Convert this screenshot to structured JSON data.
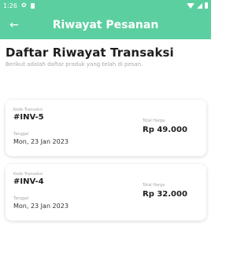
{
  "status_bar": {
    "time": "1:26"
  },
  "app_bar": {
    "title": "Riwayat Pesanan",
    "back_icon": "arrow-left-icon"
  },
  "header": {
    "title": "Daftar Riwayat Transaksi",
    "subtitle": "Berikut adalah daftar produk yang telah di pesan."
  },
  "orders": [
    {
      "code_label": "Kode Transaksi",
      "code": "#INV-5",
      "date_label": "Tanggal",
      "date": "Mon, 23 Jan 2023",
      "total_label": "Total Harga",
      "total": "Rp 49.000"
    },
    {
      "code_label": "Kode Transaksi",
      "code": "#INV-4",
      "date_label": "Tanggal",
      "date": "Mon, 23 Jan 2023",
      "total_label": "Total Harga",
      "total": "Rp 32.000"
    }
  ],
  "colors": {
    "primary": "#5ccfa0",
    "text_dark": "#1e1e1e",
    "text_muted": "#a9a9a9"
  }
}
